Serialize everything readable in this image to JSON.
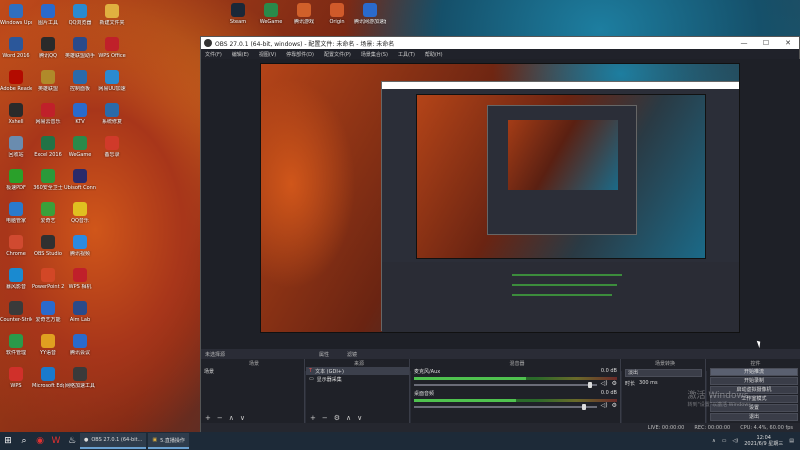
{
  "desktop_icons_left": [
    {
      "label": "Windows Update",
      "color": "#2f6fbf"
    },
    {
      "label": "Word 2016",
      "color": "#2b579a"
    },
    {
      "label": "Adobe Reader XI",
      "color": "#b30b00"
    },
    {
      "label": "Xshell",
      "color": "#2a2a2a"
    },
    {
      "label": "回收站",
      "color": "#6a8caf"
    },
    {
      "label": "极速PDF",
      "color": "#2aa02a"
    },
    {
      "label": "电脑管家",
      "color": "#2a7acc"
    },
    {
      "label": "Chrome",
      "color": "#d04a30"
    },
    {
      "label": "暴风影音",
      "color": "#1a8ad0"
    },
    {
      "label": "Counter-Strike Global Off...",
      "color": "#3a3a3a"
    },
    {
      "label": "软件管理",
      "color": "#2a9a4a"
    },
    {
      "label": "WPS",
      "color": "#d0302a"
    },
    {
      "label": "图片工具",
      "color": "#2a6acc"
    },
    {
      "label": "腾讯QQ",
      "color": "#2a2a2a"
    },
    {
      "label": "英雄联盟",
      "color": "#b08a2a"
    },
    {
      "label": "网易云音乐",
      "color": "#c0202a"
    },
    {
      "label": "Excel 2016",
      "color": "#217346"
    },
    {
      "label": "360安全卫士",
      "color": "#2a9a3a"
    },
    {
      "label": "爱奇艺",
      "color": "#3aa03a"
    },
    {
      "label": "OBS Studio",
      "color": "#303030"
    },
    {
      "label": "PowerPoint 2016",
      "color": "#d24726"
    },
    {
      "label": "爱奇艺万能",
      "color": "#2a6acc"
    },
    {
      "label": "YY语音",
      "color": "#e0a020"
    },
    {
      "label": "Microsoft Edge",
      "color": "#1a7acc"
    },
    {
      "label": "QQ浏览器",
      "color": "#2a8ad0"
    },
    {
      "label": "英雄联盟助手",
      "color": "#2a4a8a"
    },
    {
      "label": "控制面板",
      "color": "#2a6aaa"
    },
    {
      "label": "KTV",
      "color": "#2a6acc"
    },
    {
      "label": "WeGame",
      "color": "#2a8a4a"
    },
    {
      "label": "Ubisoft Connect",
      "color": "#2a2a6a"
    },
    {
      "label": "QQ音乐",
      "color": "#e0c020"
    },
    {
      "label": "腾讯视频",
      "color": "#2a8ae0"
    },
    {
      "label": "WPS 相机",
      "color": "#c0202a"
    },
    {
      "label": "Aim Lab",
      "color": "#2a4a8a"
    },
    {
      "label": "腾讯会议",
      "color": "#2a6acc"
    },
    {
      "label": "网络加速工具",
      "color": "#3a3a3a"
    },
    {
      "label": "新建文件夹",
      "color": "#e0b040"
    },
    {
      "label": "WPS Office",
      "color": "#c0202a"
    },
    {
      "label": "网易UU加速",
      "color": "#2a8ad0"
    },
    {
      "label": "系统修复",
      "color": "#2a6aaa"
    },
    {
      "label": "备忘录",
      "color": "#d03a2a"
    }
  ],
  "desktop_icons_top": [
    {
      "label": "Steam",
      "color": "#1b2838"
    },
    {
      "label": "WeGame",
      "color": "#2a8a4a"
    },
    {
      "label": "腾讯游戏",
      "color": "#d0602a"
    },
    {
      "label": "Origin",
      "color": "#d05a2a"
    },
    {
      "label": "腾讯网游加速器",
      "color": "#2a6acc"
    }
  ],
  "obs": {
    "title": "OBS 27.0.1 (64-bit, windows) - 配置文件: 未命名 - 场景: 未命名",
    "minimize": "—",
    "maximize": "☐",
    "close": "✕",
    "menu": [
      "文件(F)",
      "编辑(E)",
      "视图(V)",
      "停靠部件(D)",
      "配置文件(P)",
      "场景集合(S)",
      "工具(T)",
      "帮助(H)"
    ],
    "no_source": "未选择源",
    "properties_btn": "属性",
    "filters_btn": "滤镜",
    "docks": {
      "scenes": "场景",
      "sources": "来源",
      "mixer": "混音器",
      "transitions": "场景转换",
      "controls": "控件"
    },
    "scenes": [
      "场景"
    ],
    "sources": [
      {
        "name": "文本 (GDI+)",
        "icon": "T"
      },
      {
        "name": "显示器采集",
        "icon": "▭"
      }
    ],
    "mixer": [
      {
        "name": "麦克风/Aux",
        "db": "0.0 dB",
        "level": 0.55,
        "volume": 0.95
      },
      {
        "name": "桌面音频",
        "db": "0.0 dB",
        "level": 0.5,
        "volume": 0.92
      }
    ],
    "transition": {
      "type": "淡出",
      "duration_label": "时长",
      "duration": "300 ms"
    },
    "controls": [
      "开始推流",
      "开始录制",
      "启动虚拟摄像机",
      "工作室模式",
      "设置",
      "退出"
    ],
    "status": {
      "live": "LIVE: 00:00:00",
      "rec": "REC: 00:00:00",
      "cpu": "CPU: 4.4%, 60.00 fps"
    }
  },
  "watermark": {
    "line1": "激活 Windows",
    "line2": "转到\"设置\"以激活 Windows。"
  },
  "taskbar": {
    "start_icon": "⊞",
    "search_icon": "⌕",
    "apps": [
      {
        "label": "OBS 27.0.1 (64-bit...",
        "icon": "●"
      },
      {
        "label": "5.直播操作",
        "icon": "▣"
      }
    ],
    "time": "12:04",
    "date": "2021/6/9 星期三"
  }
}
